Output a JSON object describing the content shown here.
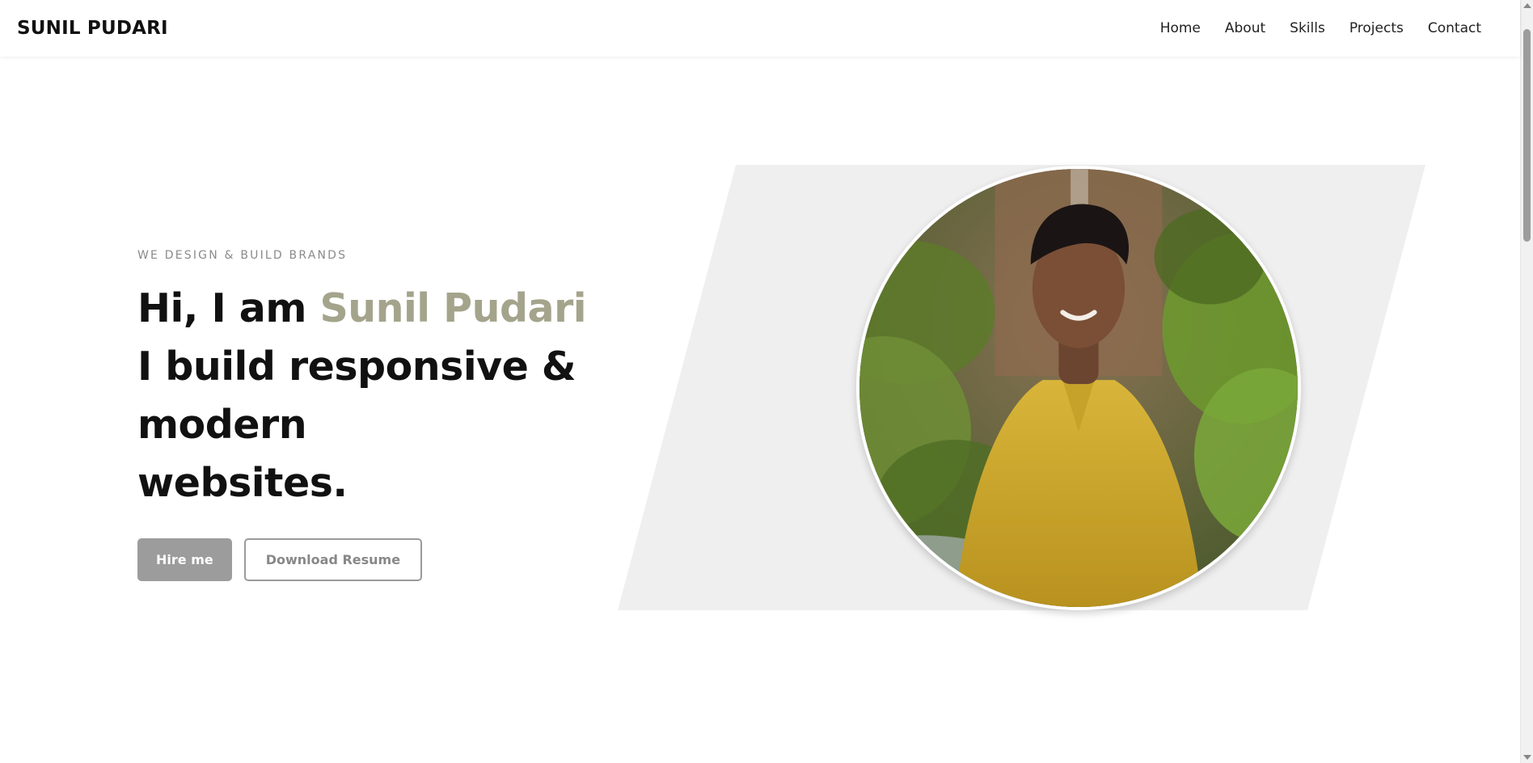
{
  "navbar": {
    "brand": "SUNIL PUDARI",
    "links": [
      "Home",
      "About",
      "Skills",
      "Projects",
      "Contact"
    ]
  },
  "hero": {
    "eyebrow": "WE DESIGN & BUILD BRANDS",
    "greeting": "Hi, I am ",
    "name": "Sunil Pudari",
    "line2": "I build responsive & modern",
    "line3": "websites.",
    "primary_button": "Hire me",
    "secondary_button": "Download Resume"
  },
  "colors": {
    "accent": "#a4a48c",
    "primary_button_bg": "#9c9c9c",
    "shape_bg": "#efefef"
  },
  "portrait": {
    "icon": "profile-photo"
  }
}
